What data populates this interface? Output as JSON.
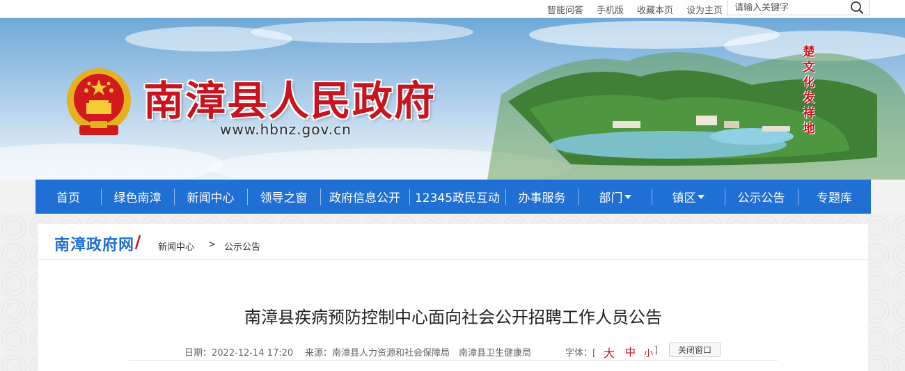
{
  "topbar": {
    "links": [
      "智能问答",
      "手机版",
      "收藏本页",
      "设为主页"
    ],
    "search_placeholder": "请输入关键字"
  },
  "banner": {
    "site_name": "南漳县人民政府",
    "url": "www.hbnz.gov.cn",
    "slogan": [
      "楚",
      "文",
      "化",
      "发",
      "祥",
      "地"
    ]
  },
  "nav": {
    "items": [
      {
        "label": "首页"
      },
      {
        "label": "绿色南漳"
      },
      {
        "label": "新闻中心"
      },
      {
        "label": "领导之窗"
      },
      {
        "label": "政府信息公开"
      },
      {
        "label": "12345政民互动"
      },
      {
        "label": "办事服务"
      },
      {
        "label": "部门"
      },
      {
        "label": "镇区"
      },
      {
        "label": "公示公告"
      },
      {
        "label": "专题库"
      }
    ]
  },
  "breadcrumb": {
    "brand": "南漳政府网",
    "level1": "新闻中心",
    "separator": ">",
    "level2": "公示公告"
  },
  "article": {
    "title": "南漳县疾病预防控制中心面向社会公开招聘工作人员公告",
    "date_label": "日期：2022-12-14 17:20",
    "source_label": "来源：南漳县人力资源和社会保障局　南漳县卫生健康局",
    "font_label": "字体：[",
    "font_large": "大",
    "font_medium": "中",
    "font_small": "小",
    "font_close": "]",
    "close_window": "关闭窗口"
  },
  "colors": {
    "nav_bg": "#1f6fd4",
    "brand_red": "#c8141e",
    "brand_blue": "#1f6fd4"
  }
}
